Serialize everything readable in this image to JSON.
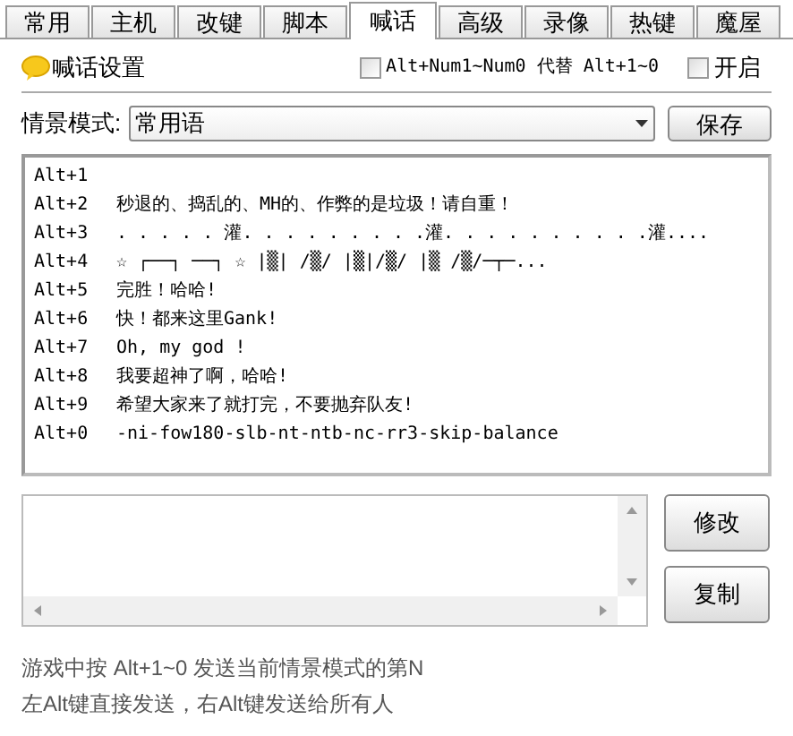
{
  "tabs": [
    {
      "label": "常用",
      "selected": false
    },
    {
      "label": "主机",
      "selected": false
    },
    {
      "label": "改键",
      "selected": false
    },
    {
      "label": "脚本",
      "selected": false
    },
    {
      "label": "喊话",
      "selected": true
    },
    {
      "label": "高级",
      "selected": false
    },
    {
      "label": "录像",
      "selected": false
    },
    {
      "label": "热键",
      "selected": false
    },
    {
      "label": "魔屋",
      "selected": false
    }
  ],
  "header": {
    "title": "喊话设置",
    "options": [
      {
        "label": "Alt+Num1~Num0 代替 Alt+1~0",
        "checked": false
      },
      {
        "label": "开启",
        "checked": false
      }
    ]
  },
  "scene": {
    "label": "情景模式:",
    "value": "常用语",
    "save_button": "保存"
  },
  "phrases": [
    {
      "key": "Alt+1"
    },
    {
      "key": "Alt+2",
      "text": "秒退的、捣乱的、MH的、作弊的是垃圾！请自重！"
    },
    {
      "key": "Alt+3",
      "text": ". . . . . 灌. . . . . . . . .灌. . . . . . . . . .灌...."
    },
    {
      "key": "Alt+4",
      "text": "☆ ┌──┐  ──┐ ☆  |▒|  /▒/  |▒|/▒/  |▒ /▒/─┬─..."
    },
    {
      "key": "Alt+5",
      "text": "完胜！哈哈!"
    },
    {
      "key": "Alt+6",
      "text": "快！都来这里Gank!"
    },
    {
      "key": "Alt+7",
      "text": "Oh, my god !"
    },
    {
      "key": "Alt+8",
      "text": "我要超神了啊，哈哈!"
    },
    {
      "key": "Alt+9",
      "text": "希望大家来了就打完，不要抛弃队友!"
    },
    {
      "key": "Alt+0",
      "text": "-ni-fow180-slb-nt-ntb-nc-rr3-skip-balance"
    }
  ],
  "editor": {
    "buttons": [
      "修改",
      "复制"
    ]
  },
  "hints": [
    "游戏中按 Alt+1~0 发送当前情景模式的第N",
    "左Alt键直接发送，右Alt键发送给所有人"
  ]
}
